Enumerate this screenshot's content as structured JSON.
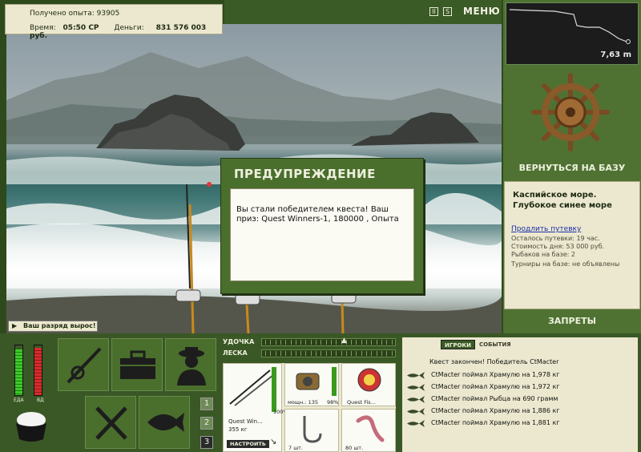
{
  "info": {
    "xp_label": "Получено опыта:",
    "xp_value": "93905",
    "time_label": "Время:",
    "time_value": "05:50 СР",
    "money_label": "Деньги:",
    "money_value": "831 576 003 руб."
  },
  "topbar": {
    "pause": "II",
    "sound": "S",
    "menu": "МЕНЮ"
  },
  "depth": {
    "value": "7,63 m"
  },
  "base": {
    "return_label": "ВЕРНУТЬСЯ НА БАЗУ"
  },
  "location": {
    "title": "Каспийское море. Глубокое синее море",
    "extend_link": "Продлить путевку",
    "trip_left": "Осталось путевки: 19 час.",
    "day_cost": "Стоимость дня: 53 000 руб.",
    "anglers": "Рыбаков на базе: 2",
    "tournaments": "Турниры на базе: не объявлены"
  },
  "bans_label": "ЗАПРЕТЫ",
  "levelup": "Ваш разряд вырос!",
  "dialog": {
    "title": "ПРЕДУПРЕЖДЕНИЕ",
    "message": "Вы стали победителем квеста! Ваш приз: Quest Winners-1, 180000 , Опыта"
  },
  "meters": {
    "food_label": "ЕДА",
    "food_fill": 0.92,
    "vd_label": "ВД",
    "vd_fill": 0.95,
    "food_color": "#3ccb2a",
    "vd_color": "#d92b2b"
  },
  "slots": [
    "1",
    "2",
    "3"
  ],
  "active_slot": "3",
  "tackle": {
    "rod_label": "УДОЧКА",
    "line_label": "ЛЕСКА",
    "rod_name": "Quest Win...",
    "rod_weight": "355 кг",
    "rod_pct": "100%",
    "reel_caption": "мощн.: 135",
    "reel_pct": "98%",
    "lure_caption": "Quest Fis...",
    "hook_caption": "7 шт.",
    "bait_caption": "80 шт.",
    "configure": "НАСТРОИТЬ"
  },
  "events": {
    "tab_players": "ИГРОКИ",
    "tab_events": "СОБЫТИЯ",
    "finish": "Квест закончен! Победитель CtMacter",
    "rows": [
      "CtMacter поймал Храмулю на 1,978 кг",
      "CtMacter поймал Храмулю на 1,972 кг",
      "CtMacter поймал Рыбца на 690 грамм",
      "CtMacter поймал Храмулю на 1,886 кг",
      "CtMacter поймал Храмулю на 1,881 кг"
    ]
  },
  "colors": {
    "panel_green": "#4a6e2c",
    "dark_green": "#3a5826",
    "cream": "#ece8cf"
  }
}
